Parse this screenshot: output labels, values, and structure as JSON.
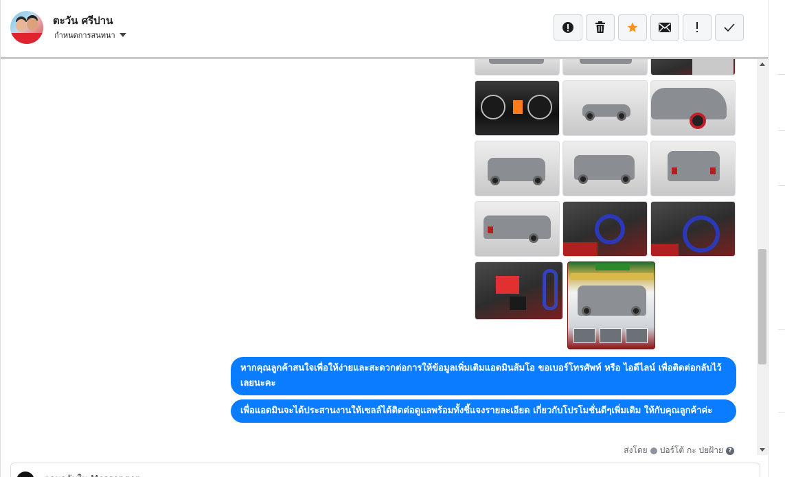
{
  "header": {
    "contact_name": "ตะวัน ศรีปาน",
    "assign_label": "กำหนดการสนทนา"
  },
  "toolbar": {
    "buttons": [
      {
        "icon": "alert-circle-icon"
      },
      {
        "icon": "trash-icon"
      },
      {
        "icon": "star-icon",
        "color": "#f7931e"
      },
      {
        "icon": "envelope-icon"
      },
      {
        "icon": "exclamation-icon"
      },
      {
        "icon": "checkmark-icon"
      }
    ]
  },
  "messages": [
    {
      "text": "หากคุณลูกค้าสนใจเพื่อให้ง่ายและสะดวกต่อการให้ข้อมูลเพิ่มเติมแอดมินส้มโอ ขอเบอร์โทรศัพท์ หรือ ไอดีไลน์ เพื่อติดต่อกลับไว้เลยนะคะ"
    },
    {
      "text": "เพื่อแอดมินจะได้ประสานงานให้เซลล์ได้ติดต่อดูแลพร้อมทั้งชี้แจงรายละเอียด เกี่ยวกับโปรโมชั่นดีๆเพิ่มเติม ให้กับคุณลูกค้าค่ะ"
    }
  ],
  "sent_by": {
    "prefix": "ส่งโดย",
    "name": "ปอร์โต้ กะ ปยฝ้าย"
  },
  "composer": {
    "placeholder": "ตอบกลับใน Messenger"
  },
  "colors": {
    "bubble": "#0a7cff",
    "star": "#f7931e"
  }
}
